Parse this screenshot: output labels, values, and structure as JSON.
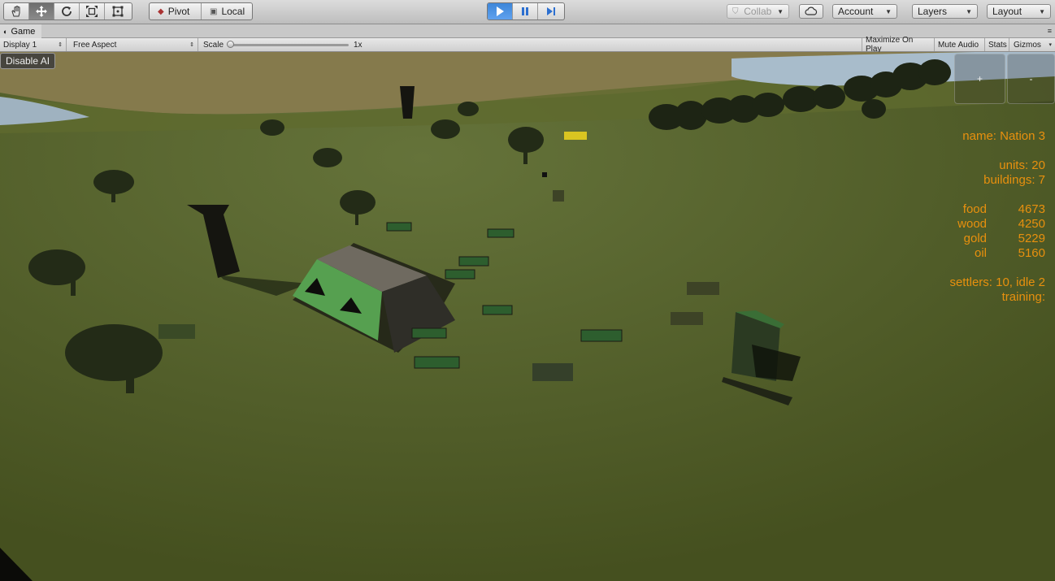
{
  "toolbar": {
    "pivot_label": "Pivot",
    "local_label": "Local",
    "collab_label": "Collab",
    "account_label": "Account",
    "layers_label": "Layers",
    "layout_label": "Layout",
    "tools": [
      "hand-icon",
      "move-icon",
      "rotate-icon",
      "scale-icon",
      "rect-icon"
    ]
  },
  "tabbar": {
    "game_tab_label": "Game"
  },
  "gamebar": {
    "display_label": "Display 1",
    "aspect_label": "Free Aspect",
    "scale_label": "Scale",
    "scale_value": "1x",
    "scale_fraction": 0,
    "maximize_label": "Maximize On Play",
    "mute_label": "Mute Audio",
    "stats_label": "Stats",
    "gizmos_label": "Gizmos"
  },
  "game": {
    "disable_ai_label": "Disable AI",
    "zoom_in_label": "+",
    "zoom_out_label": "-",
    "hud": {
      "name_line": "name: Nation 3",
      "units_line": "units: 20",
      "buildings_line": "buildings: 7",
      "resources": [
        {
          "name": "food",
          "value": "4673"
        },
        {
          "name": "wood",
          "value": "4250"
        },
        {
          "name": "gold",
          "value": "5229"
        },
        {
          "name": "oil",
          "value": "5160"
        }
      ],
      "settlers_line": "settlers: 10, idle 2",
      "training_line": "training:"
    },
    "colors": {
      "hud_text": "#e8900e",
      "grass": "#4e5a26",
      "play_active": "#3d86d9"
    }
  }
}
